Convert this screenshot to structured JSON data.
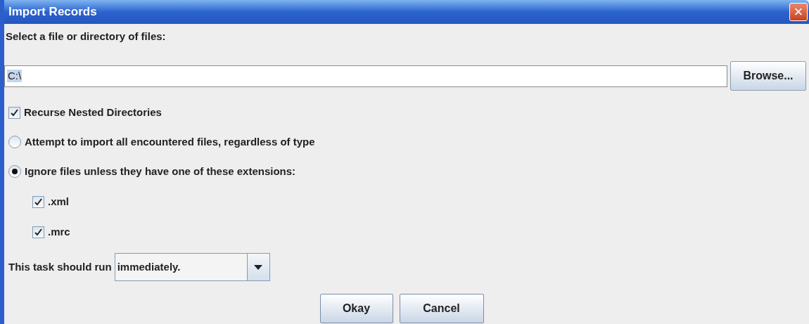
{
  "window": {
    "title": "Import Records",
    "close": "×"
  },
  "file_label": "Select a file or directory of files:",
  "path_field": {
    "value": "C:\\"
  },
  "browse_button": "Browse...",
  "recurse": {
    "label": "Recurse Nested Directories",
    "checked": true
  },
  "mode_options": [
    {
      "label": "Attempt to import all encountered files, regardless of type",
      "selected": false
    },
    {
      "label": "Ignore files unless they have one of these extensions:",
      "selected": true
    }
  ],
  "extensions": [
    {
      "label": ".xml",
      "checked": true
    },
    {
      "label": ".mrc",
      "checked": true
    }
  ],
  "schedule": {
    "label": "This task should run",
    "value": "immediately."
  },
  "buttons": [
    "Okay",
    "Cancel"
  ]
}
